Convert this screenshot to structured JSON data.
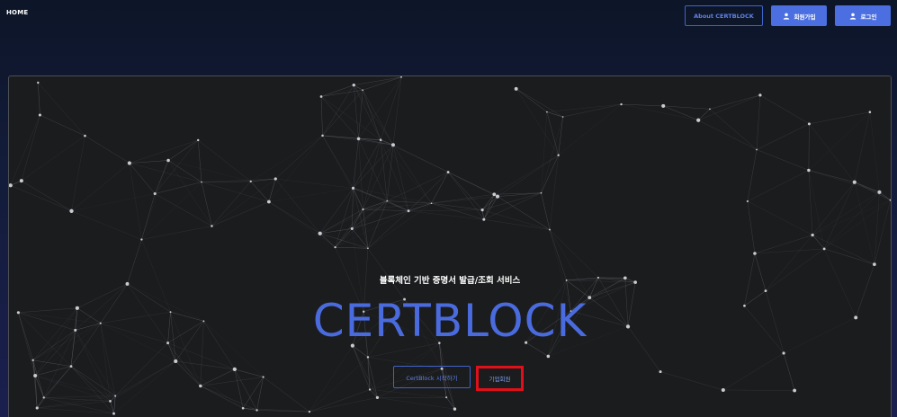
{
  "header": {
    "home_label": "HOME",
    "about_label": "About CERTBLOCK",
    "signup_label": "회원가입",
    "login_label": "로그인",
    "user_icon": "user-icon"
  },
  "hero": {
    "subtitle": "블록체인 기반 증명서 발급/조회 서비스",
    "brand": "CERTBLOCK",
    "start_button": "CertBlock 시작하기",
    "corporate_button": "기업회원"
  },
  "colors": {
    "accent": "#4b6fe0",
    "brand_text": "#4a6bde",
    "highlight": "#e0101a",
    "hero_bg": "#1b1c1e"
  }
}
